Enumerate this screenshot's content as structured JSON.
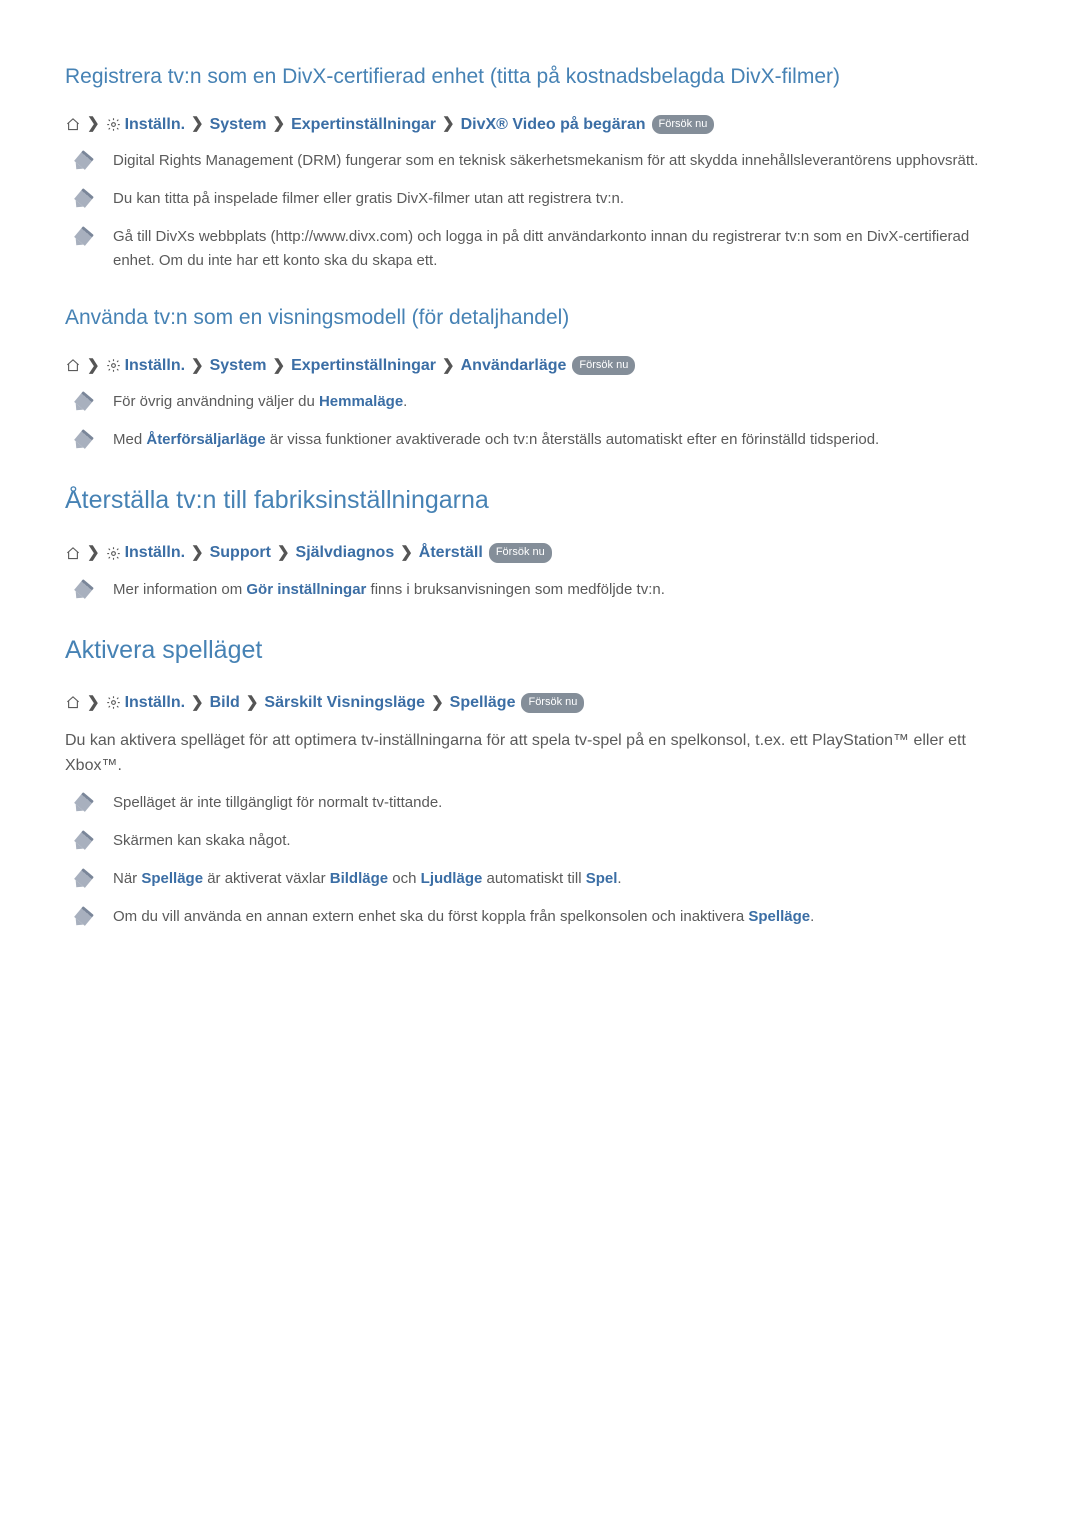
{
  "labels": {
    "trynow": "Försök nu",
    "settings": "Inställn."
  },
  "section1": {
    "title": "Registrera tv:n som en DivX-certifierad enhet (titta på kostnadsbelagda DivX-filmer)",
    "crumbs": {
      "c1": "System",
      "c2": " Expertinställningar",
      "c3": "DivX® Video på begäran"
    },
    "notes": {
      "n1": "Digital Rights Management (DRM) fungerar som en teknisk säkerhetsmekanism för att skydda innehållsleverantörens upphovsrätt.",
      "n2": "Du kan titta på inspelade filmer eller gratis DivX-filmer utan att registrera tv:n.",
      "n3": "Gå till DivXs webbplats (http://www.divx.com) och logga in på ditt användarkonto innan du registrerar tv:n som en DivX-certifierad enhet. Om du inte har ett konto ska du skapa ett."
    }
  },
  "section2": {
    "title": "Använda tv:n som en visningsmodell (för detaljhandel)",
    "crumbs": {
      "c1": "System",
      "c2": "Expertinställningar",
      "c3": "Användarläge"
    },
    "notes": {
      "n1_pre": "För övrig användning väljer du ",
      "n1_link": "Hemmaläge",
      "n1_post": ".",
      "n2_pre": "Med ",
      "n2_link": "Återförsäljarläge",
      "n2_post": " är vissa funktioner avaktiverade och tv:n återställs automatiskt efter en förinställd tidsperiod."
    }
  },
  "section3": {
    "title": "Återställa tv:n till fabriksinställningarna",
    "crumbs": {
      "c1": "Support",
      "c2": "Självdiagnos",
      "c3": "Återställ"
    },
    "notes": {
      "n1_pre": "Mer information om ",
      "n1_link": "Gör inställningar",
      "n1_post": " finns i bruksanvisningen som medföljde tv:n."
    }
  },
  "section4": {
    "title": "Aktivera spelläget",
    "crumbs": {
      "c1": "Bild",
      "c2": "Särskilt Visningsläge",
      "c3": "Spelläge"
    },
    "body": "Du kan aktivera spelläget för att optimera tv-inställningarna för att spela tv-spel på en spelkonsol, t.ex. ett PlayStation™ eller ett Xbox™.",
    "notes": {
      "n1": "Spelläget är inte tillgängligt för normalt tv-tittande.",
      "n2": "Skärmen kan skaka något.",
      "n3_pre": "När ",
      "n3_l1": "Spelläge",
      "n3_mid1": " är aktiverat växlar ",
      "n3_l2": "Bildläge",
      "n3_mid2": " och ",
      "n3_l3": "Ljudläge",
      "n3_mid3": " automatiskt till ",
      "n3_l4": "Spel",
      "n3_post": ".",
      "n4_pre": "Om du vill använda en annan extern enhet ska du först koppla från spelkonsolen och inaktivera ",
      "n4_link": "Spelläge",
      "n4_post": "."
    }
  }
}
